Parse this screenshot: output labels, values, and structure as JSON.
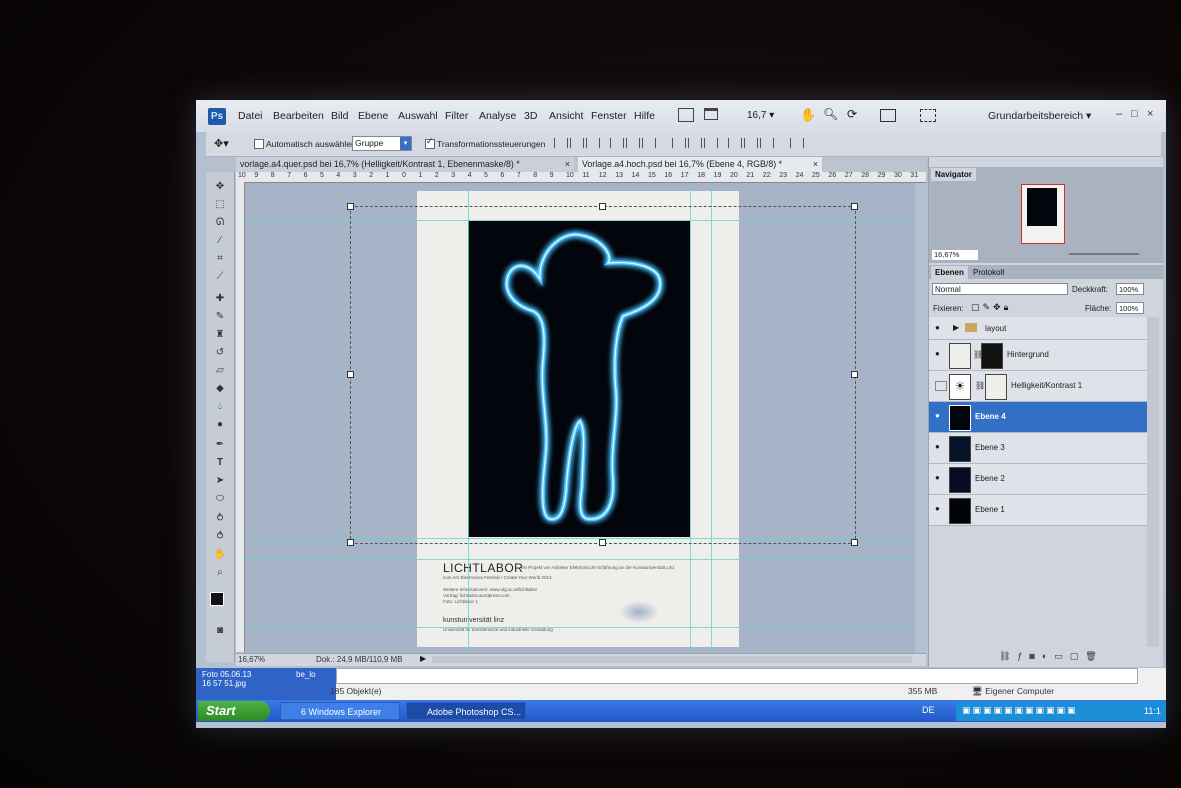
{
  "menubar": {
    "logo": "Ps",
    "items": [
      "Datei",
      "Bearbeiten",
      "Bild",
      "Ebene",
      "Auswahl",
      "Filter",
      "Analyse",
      "3D",
      "Ansicht",
      "Fenster",
      "Hilfe"
    ],
    "zoom": "16,7",
    "workspace": "Grundarbeitsbereich",
    "window_controls": [
      "–",
      "□",
      "×"
    ]
  },
  "options_bar": {
    "auto_select_label": "Automatisch auswählen:",
    "auto_select_value": "Gruppe",
    "transform_label": "Transformationssteuerungen",
    "transform_checked": true
  },
  "tabs": [
    {
      "label": "vorlage.a4.quer.psd bei 16,7% (Helligkeit/Kontrast 1, Ebenenmaske/8) *",
      "active": false
    },
    {
      "label": "Vorlage.a4.hoch.psd bei 16,7% (Ebene 4, RGB/8) *",
      "active": true
    }
  ],
  "ruler": {
    "top_ticks": [
      "10",
      "9",
      "8",
      "7",
      "6",
      "5",
      "4",
      "3",
      "2",
      "1",
      "0",
      "1",
      "2",
      "3",
      "4",
      "5",
      "6",
      "7",
      "8",
      "9",
      "10",
      "11",
      "12",
      "13",
      "14",
      "15",
      "16",
      "17",
      "18",
      "19",
      "20",
      "21",
      "22",
      "23",
      "24",
      "25",
      "26",
      "27",
      "28",
      "29",
      "30",
      "31"
    ]
  },
  "document": {
    "title": "LICHTLABOR",
    "title_suffix": "ein Projekt von Anbieter Elektronische Erfahrung an der Kunstuniversität Linz",
    "line2": "zum Ars Electronica Festival • Create Your World 2013",
    "info1": "Weitere Informationen: www.ufg.ac.at/lichtlabor",
    "info2": "Vortrag: lichtlabor.wordpress.com",
    "info3": "Foto: Lichtlabor 1",
    "logo": "kunstuniversität linz",
    "logo_sub": "Universität für künstlerische und industrielle Gestaltung"
  },
  "status": {
    "zoom": "16,67%",
    "doc_size": "Dok.: 24,9 MB/110,9 MB"
  },
  "navigator": {
    "tab": "Navigator",
    "zoom": "16,67%"
  },
  "layers_panel": {
    "tabs": [
      "Ebenen",
      "Protokoll"
    ],
    "blend_mode": "Normal",
    "opacity_label": "Deckkraft:",
    "opacity_value": "100%",
    "lock_label": "Fixieren:",
    "fill_label": "Fläche:",
    "fill_value": "100%",
    "layers": [
      {
        "name": "layout",
        "type": "group",
        "visible": true,
        "selected": false
      },
      {
        "name": "Hintergrund",
        "type": "masked",
        "visible": true,
        "selected": false
      },
      {
        "name": "Helligkeit/Kontrast 1",
        "type": "adjustment",
        "visible": false,
        "selected": false
      },
      {
        "name": "Ebene 4",
        "type": "image",
        "visible": true,
        "selected": true
      },
      {
        "name": "Ebene 3",
        "type": "image",
        "visible": true,
        "selected": false
      },
      {
        "name": "Ebene 2",
        "type": "image",
        "visible": true,
        "selected": false
      },
      {
        "name": "Ebene 1",
        "type": "image",
        "visible": true,
        "selected": false
      }
    ]
  },
  "explorer": {
    "file_label": "Foto 05.06.13 16 57 51.jpg",
    "file_label2": "be_lo",
    "objects": "185 Objekt(e)",
    "size": "355 MB",
    "location": "Eigener Computer"
  },
  "taskbar": {
    "start": "Start",
    "buttons": [
      "6 Windows Explorer",
      "Adobe Photoshop CS..."
    ],
    "lang": "DE",
    "clock": "11:1"
  },
  "colors": {
    "accent_selected": "#3170c4",
    "taskbar": "#2457c8",
    "glow": "#4fc6ff"
  }
}
